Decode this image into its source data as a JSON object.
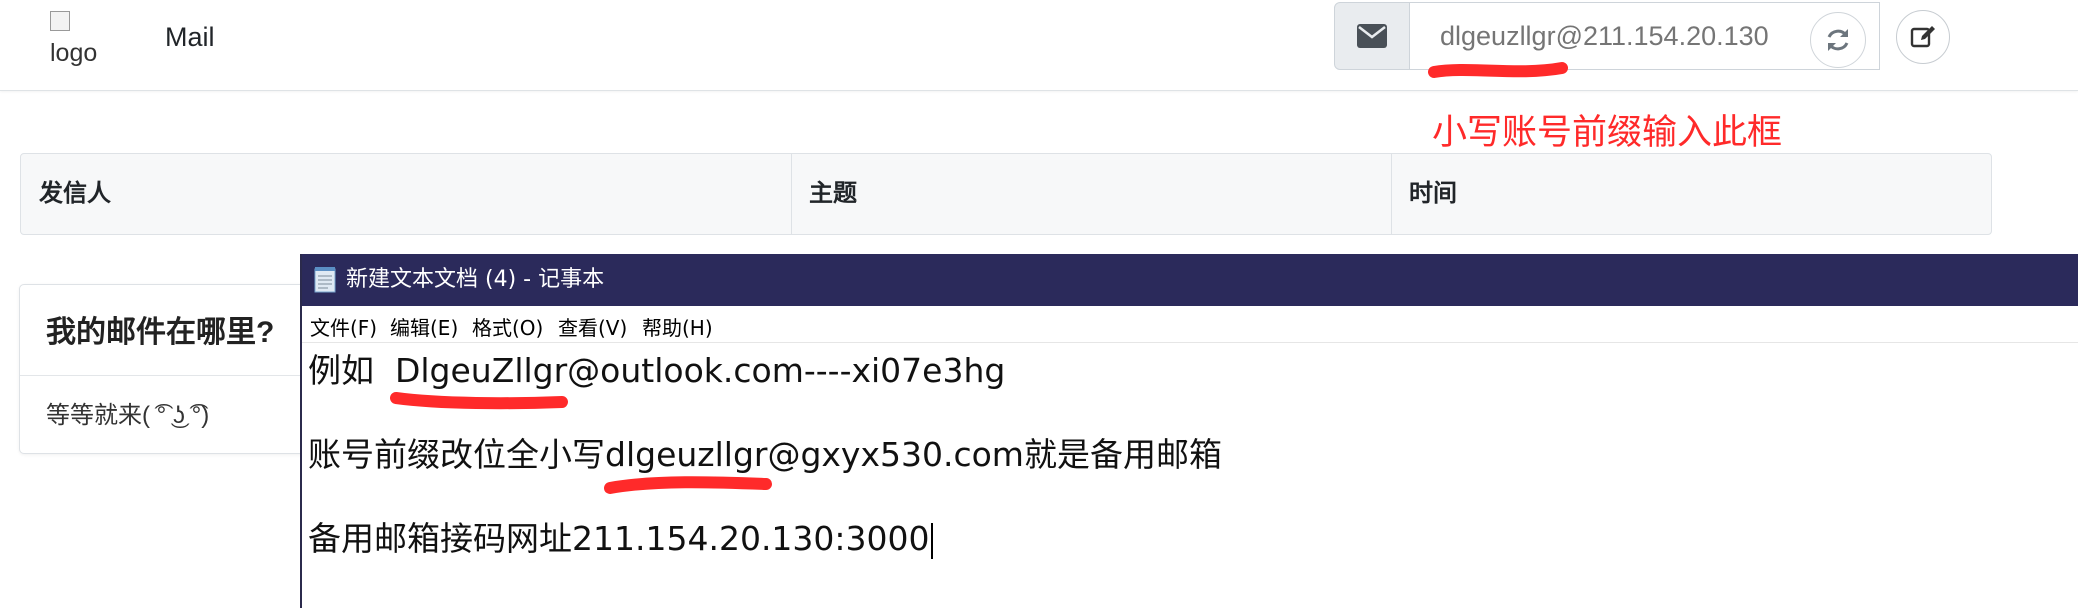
{
  "navbar": {
    "logo_alt": "logo",
    "brand": "Mail",
    "address_placeholder": "dlgeuzllgr@211.154.20.130",
    "mail_icon": "envelope-icon",
    "refresh_icon": "refresh-icon",
    "compose_icon": "edit-icon"
  },
  "annotation": {
    "note": "小写账号前缀输入此框",
    "color": "#ff2a2a"
  },
  "mail_table": {
    "columns": [
      "发信人",
      "主题",
      "时间"
    ]
  },
  "help_card": {
    "title": "我的邮件在哪里?",
    "body": "等等就来( ͡° ͜ʖ ͡°)"
  },
  "notepad": {
    "title": "新建文本文档 (4) - 记事本",
    "menu": [
      "文件(F)",
      "编辑(E)",
      "格式(O)",
      "查看(V)",
      "帮助(H)"
    ],
    "lines": [
      "例如  DlgeuZllgr@outlook.com----xi07e3hg",
      "账号前缀改位全小写dlgeuzllgr@gxyx530.com就是备用邮箱",
      "备用邮箱接码网址211.154.20.130:3000"
    ],
    "titlebar_color": "#2b2a5b"
  }
}
